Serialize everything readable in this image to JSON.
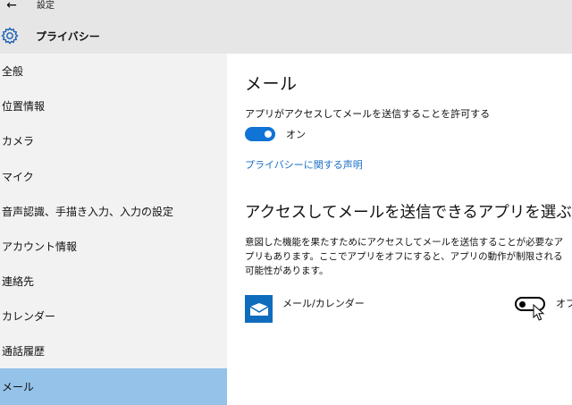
{
  "window": {
    "back_glyph": "←",
    "title": "設定"
  },
  "header": {
    "icon": "gear-icon",
    "title": "プライバシー"
  },
  "sidebar": {
    "items": [
      {
        "label": "全般"
      },
      {
        "label": "位置情報"
      },
      {
        "label": "カメラ"
      },
      {
        "label": "マイク"
      },
      {
        "label": "音声認識、手描き入力、入力の設定"
      },
      {
        "label": "アカウント情報"
      },
      {
        "label": "連絡先"
      },
      {
        "label": "カレンダー"
      },
      {
        "label": "通話履歴"
      },
      {
        "label": "メール"
      }
    ],
    "selected": "メール"
  },
  "main": {
    "heading": "メール",
    "allow_label": "アプリがアクセスしてメールを送信することを許可する",
    "allow_toggle": {
      "state": "on",
      "label": "オン"
    },
    "privacy_link": "プライバシーに関する声明",
    "apps_heading": "アクセスしてメールを送信できるアプリを選ぶ",
    "description": "意図した機能を果たすためにアクセスしてメールを送信することが必要なアプリもあります。ここでアプリをオフにすると、アプリの動作が制限される可能性があります。",
    "apps": [
      {
        "name": "メール/カレンダー",
        "icon": "mail-icon",
        "toggle_state": "off",
        "toggle_label": "オフ"
      }
    ]
  },
  "colors": {
    "accent": "#1073d6",
    "selected_nav": "#94c2e8",
    "titlebar": "#e6e6e6",
    "sidebar": "#f2f2f2",
    "link": "#1a6fc4",
    "app_tile": "#0f6cbd"
  }
}
